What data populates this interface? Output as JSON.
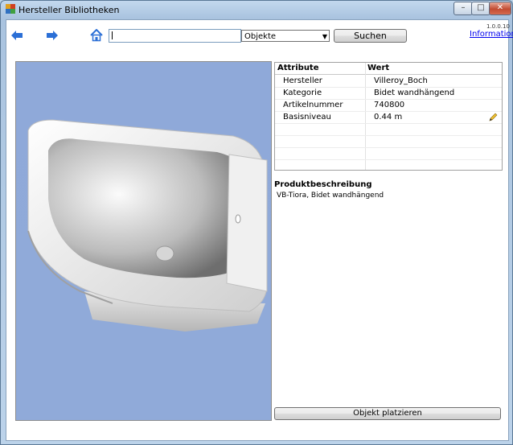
{
  "window": {
    "title": "Hersteller Bibliotheken",
    "close_label": "✕",
    "max_label": "□",
    "min_label": "–"
  },
  "toolbar": {
    "search_value": "",
    "filter_selected": "Objekte",
    "search_button": "Suchen",
    "version": "1.0.0.10",
    "info_link": "Information"
  },
  "properties": {
    "header_attribute": "Attribute",
    "header_value": "Wert",
    "rows": [
      {
        "attribute": "Hersteller",
        "value": "Villeroy_Boch"
      },
      {
        "attribute": "Kategorie",
        "value": "Bidet wandhängend"
      },
      {
        "attribute": "Artikelnummer",
        "value": "740800"
      },
      {
        "attribute": "Basisniveau",
        "value": "0.44 m"
      }
    ]
  },
  "description": {
    "title": "Produktbeschreibung",
    "text": "VB-Tiora, Bidet wandhängend"
  },
  "actions": {
    "place_button": "Objekt platzieren"
  },
  "colors": {
    "viewport_bg": "#8fa9d9",
    "accent_arrow": "#2b6fd6",
    "link": "#0000ee"
  },
  "icons": {
    "back": "arrow-left-icon",
    "forward": "arrow-right-icon",
    "home": "home-icon",
    "edit": "pencil-icon"
  }
}
